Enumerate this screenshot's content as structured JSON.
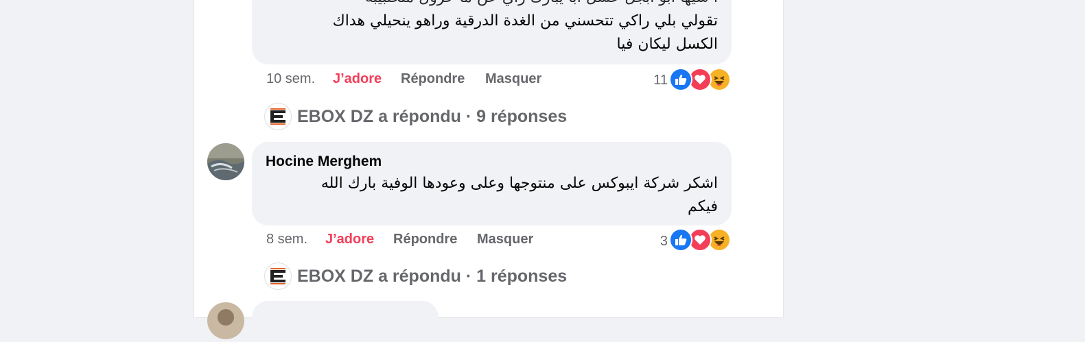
{
  "comments": [
    {
      "text_partial": "تقولي بلي راكي تتحسني من الغدة الدرقية وراهو ينحيلي هداك",
      "text_line2": "الكسل ليكان فيا",
      "time": "10 sem.",
      "actions": {
        "love": "J’adore",
        "reply": "Répondre",
        "hide": "Masquer"
      },
      "reaction_count": "11",
      "reply_summary": {
        "author": "EBOX DZ",
        "text": "a répondu · 9 réponses"
      }
    },
    {
      "author": "Hocine Merghem",
      "text_line1": "اشكر شركة ايبوكس على منتوجها وعلى وعودها الوفية بارك الله",
      "text_line2": "فيكم",
      "time": "8 sem.",
      "actions": {
        "love": "J’adore",
        "reply": "Répondre",
        "hide": "Masquer"
      },
      "reaction_count": "3",
      "reply_summary": {
        "author": "EBOX DZ",
        "text": "a répondu · 1 réponses"
      }
    }
  ],
  "icons": {
    "like": "like-reaction-icon",
    "love": "love-reaction-icon",
    "haha": "haha-reaction-icon",
    "page_logo": "ebox-logo-icon"
  },
  "colors": {
    "like_blue": "#1877f2",
    "love_red": "#f33e58",
    "haha_yellow": "#f7b125",
    "bubble_bg": "#f0f2f5",
    "secondary_text": "#65676b"
  }
}
